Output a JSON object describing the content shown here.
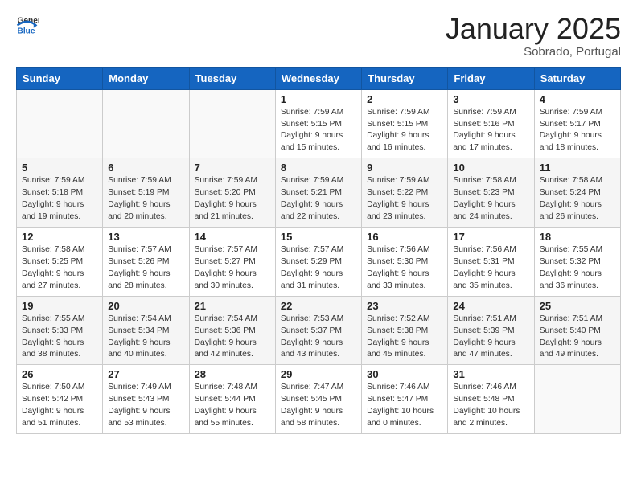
{
  "logo": {
    "general": "General",
    "blue": "Blue"
  },
  "header": {
    "month": "January 2025",
    "location": "Sobrado, Portugal"
  },
  "weekdays": [
    "Sunday",
    "Monday",
    "Tuesday",
    "Wednesday",
    "Thursday",
    "Friday",
    "Saturday"
  ],
  "weeks": [
    [
      {
        "day": "",
        "info": ""
      },
      {
        "day": "",
        "info": ""
      },
      {
        "day": "",
        "info": ""
      },
      {
        "day": "1",
        "info": "Sunrise: 7:59 AM\nSunset: 5:15 PM\nDaylight: 9 hours\nand 15 minutes."
      },
      {
        "day": "2",
        "info": "Sunrise: 7:59 AM\nSunset: 5:15 PM\nDaylight: 9 hours\nand 16 minutes."
      },
      {
        "day": "3",
        "info": "Sunrise: 7:59 AM\nSunset: 5:16 PM\nDaylight: 9 hours\nand 17 minutes."
      },
      {
        "day": "4",
        "info": "Sunrise: 7:59 AM\nSunset: 5:17 PM\nDaylight: 9 hours\nand 18 minutes."
      }
    ],
    [
      {
        "day": "5",
        "info": "Sunrise: 7:59 AM\nSunset: 5:18 PM\nDaylight: 9 hours\nand 19 minutes."
      },
      {
        "day": "6",
        "info": "Sunrise: 7:59 AM\nSunset: 5:19 PM\nDaylight: 9 hours\nand 20 minutes."
      },
      {
        "day": "7",
        "info": "Sunrise: 7:59 AM\nSunset: 5:20 PM\nDaylight: 9 hours\nand 21 minutes."
      },
      {
        "day": "8",
        "info": "Sunrise: 7:59 AM\nSunset: 5:21 PM\nDaylight: 9 hours\nand 22 minutes."
      },
      {
        "day": "9",
        "info": "Sunrise: 7:59 AM\nSunset: 5:22 PM\nDaylight: 9 hours\nand 23 minutes."
      },
      {
        "day": "10",
        "info": "Sunrise: 7:58 AM\nSunset: 5:23 PM\nDaylight: 9 hours\nand 24 minutes."
      },
      {
        "day": "11",
        "info": "Sunrise: 7:58 AM\nSunset: 5:24 PM\nDaylight: 9 hours\nand 26 minutes."
      }
    ],
    [
      {
        "day": "12",
        "info": "Sunrise: 7:58 AM\nSunset: 5:25 PM\nDaylight: 9 hours\nand 27 minutes."
      },
      {
        "day": "13",
        "info": "Sunrise: 7:57 AM\nSunset: 5:26 PM\nDaylight: 9 hours\nand 28 minutes."
      },
      {
        "day": "14",
        "info": "Sunrise: 7:57 AM\nSunset: 5:27 PM\nDaylight: 9 hours\nand 30 minutes."
      },
      {
        "day": "15",
        "info": "Sunrise: 7:57 AM\nSunset: 5:29 PM\nDaylight: 9 hours\nand 31 minutes."
      },
      {
        "day": "16",
        "info": "Sunrise: 7:56 AM\nSunset: 5:30 PM\nDaylight: 9 hours\nand 33 minutes."
      },
      {
        "day": "17",
        "info": "Sunrise: 7:56 AM\nSunset: 5:31 PM\nDaylight: 9 hours\nand 35 minutes."
      },
      {
        "day": "18",
        "info": "Sunrise: 7:55 AM\nSunset: 5:32 PM\nDaylight: 9 hours\nand 36 minutes."
      }
    ],
    [
      {
        "day": "19",
        "info": "Sunrise: 7:55 AM\nSunset: 5:33 PM\nDaylight: 9 hours\nand 38 minutes."
      },
      {
        "day": "20",
        "info": "Sunrise: 7:54 AM\nSunset: 5:34 PM\nDaylight: 9 hours\nand 40 minutes."
      },
      {
        "day": "21",
        "info": "Sunrise: 7:54 AM\nSunset: 5:36 PM\nDaylight: 9 hours\nand 42 minutes."
      },
      {
        "day": "22",
        "info": "Sunrise: 7:53 AM\nSunset: 5:37 PM\nDaylight: 9 hours\nand 43 minutes."
      },
      {
        "day": "23",
        "info": "Sunrise: 7:52 AM\nSunset: 5:38 PM\nDaylight: 9 hours\nand 45 minutes."
      },
      {
        "day": "24",
        "info": "Sunrise: 7:51 AM\nSunset: 5:39 PM\nDaylight: 9 hours\nand 47 minutes."
      },
      {
        "day": "25",
        "info": "Sunrise: 7:51 AM\nSunset: 5:40 PM\nDaylight: 9 hours\nand 49 minutes."
      }
    ],
    [
      {
        "day": "26",
        "info": "Sunrise: 7:50 AM\nSunset: 5:42 PM\nDaylight: 9 hours\nand 51 minutes."
      },
      {
        "day": "27",
        "info": "Sunrise: 7:49 AM\nSunset: 5:43 PM\nDaylight: 9 hours\nand 53 minutes."
      },
      {
        "day": "28",
        "info": "Sunrise: 7:48 AM\nSunset: 5:44 PM\nDaylight: 9 hours\nand 55 minutes."
      },
      {
        "day": "29",
        "info": "Sunrise: 7:47 AM\nSunset: 5:45 PM\nDaylight: 9 hours\nand 58 minutes."
      },
      {
        "day": "30",
        "info": "Sunrise: 7:46 AM\nSunset: 5:47 PM\nDaylight: 10 hours\nand 0 minutes."
      },
      {
        "day": "31",
        "info": "Sunrise: 7:46 AM\nSunset: 5:48 PM\nDaylight: 10 hours\nand 2 minutes."
      },
      {
        "day": "",
        "info": ""
      }
    ]
  ]
}
